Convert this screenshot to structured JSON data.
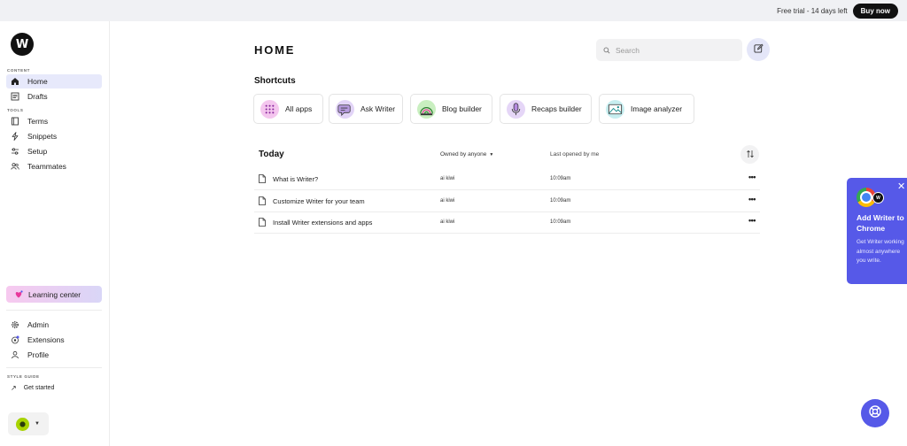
{
  "topbar": {
    "trial_text": "Free trial - 14 days left",
    "buy_label": "Buy now"
  },
  "brand": {
    "logo_letter": "W",
    "accent": "#5659e8"
  },
  "sidebar": {
    "content_label": "CONTENT",
    "tools_label": "TOOLS",
    "content_items": [
      {
        "label": "Home",
        "icon": "home-icon",
        "active": true
      },
      {
        "label": "Drafts",
        "icon": "drafts-icon"
      }
    ],
    "tools_items": [
      {
        "label": "Terms",
        "icon": "book-icon"
      },
      {
        "label": "Snippets",
        "icon": "lightning-icon"
      },
      {
        "label": "Setup",
        "icon": "sliders-icon"
      },
      {
        "label": "Teammates",
        "icon": "users-icon"
      }
    ],
    "learning_center": "Learning center",
    "bottom_items": [
      {
        "label": "Admin",
        "icon": "gear-icon"
      },
      {
        "label": "Extensions",
        "icon": "extensions-icon"
      },
      {
        "label": "Profile",
        "icon": "user-icon"
      }
    ],
    "style_guide_label": "STYLE GUIDE",
    "get_started": "Get started"
  },
  "main": {
    "title": "HOME",
    "search_placeholder": "Search",
    "shortcuts_heading": "Shortcuts",
    "shortcuts": [
      {
        "label": "All apps",
        "icon": "grid-icon"
      },
      {
        "label": "Ask Writer",
        "icon": "chat-icon"
      },
      {
        "label": "Blog builder",
        "icon": "blog-icon"
      },
      {
        "label": "Recaps builder",
        "icon": "microphone-icon"
      },
      {
        "label": "Image analyzer",
        "icon": "image-icon"
      }
    ],
    "today_heading": "Today",
    "owned_filter": "Owned by anyone",
    "last_opened": "Last opened by me",
    "rows": [
      {
        "title": "What is Writer?",
        "owner": "ai kiwi",
        "time": "10:09am"
      },
      {
        "title": "Customize Writer for your team",
        "owner": "ai kiwi",
        "time": "10:09am"
      },
      {
        "title": "Install Writer extensions and apps",
        "owner": "ai kiwi",
        "time": "10:09am"
      }
    ]
  },
  "promo": {
    "title": "Add Writer to Chrome",
    "body": "Get Writer working almost anywhere you write.",
    "close": "✕"
  }
}
